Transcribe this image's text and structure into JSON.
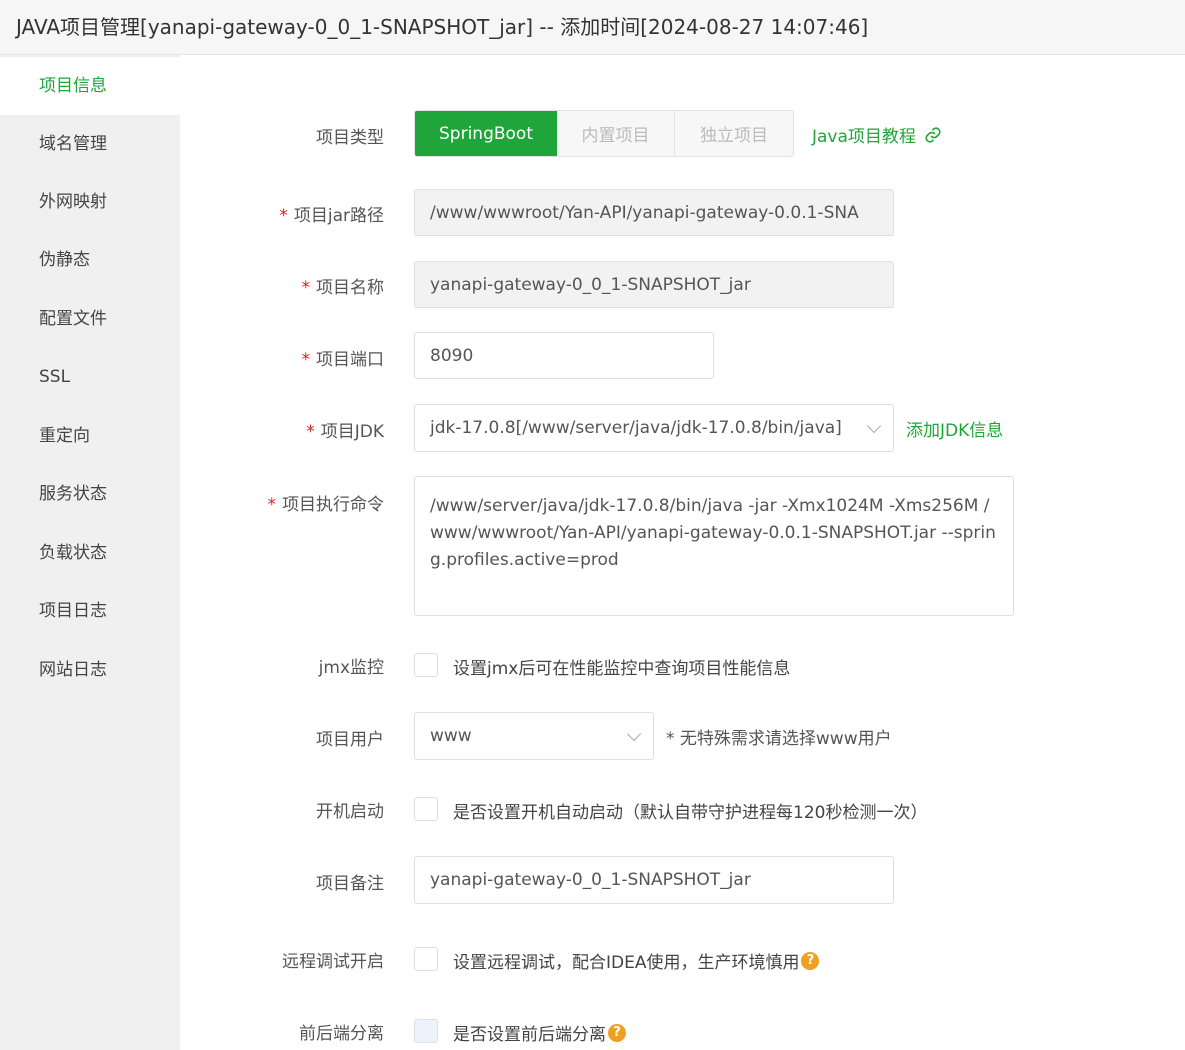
{
  "window": {
    "title": "JAVA项目管理[yanapi-gateway-0_0_1-SNAPSHOT_jar] -- 添加时间[2024-08-27 14:07:46]"
  },
  "sidebar": {
    "items": [
      {
        "label": "项目信息",
        "active": true
      },
      {
        "label": "域名管理"
      },
      {
        "label": "外网映射"
      },
      {
        "label": "伪静态"
      },
      {
        "label": "配置文件"
      },
      {
        "label": "SSL"
      },
      {
        "label": "重定向"
      },
      {
        "label": "服务状态"
      },
      {
        "label": "负载状态"
      },
      {
        "label": "项目日志"
      },
      {
        "label": "网站日志"
      }
    ]
  },
  "form": {
    "type": {
      "label": "项目类型",
      "options": [
        "SpringBoot",
        "内置项目",
        "独立项目"
      ],
      "selected": "SpringBoot",
      "tutorial_link": "Java项目教程"
    },
    "jar_path": {
      "label": "项目jar路径",
      "value": "/www/wwwroot/Yan-API/yanapi-gateway-0.0.1-SNA"
    },
    "name": {
      "label": "项目名称",
      "value": "yanapi-gateway-0_0_1-SNAPSHOT_jar"
    },
    "port": {
      "label": "项目端口",
      "value": "8090"
    },
    "jdk": {
      "label": "项目JDK",
      "value": "jdk-17.0.8[/www/server/java/jdk-17.0.8/bin/java]",
      "add_link": "添加JDK信息"
    },
    "command": {
      "label": "项目执行命令",
      "value": "/www/server/java/jdk-17.0.8/bin/java  -jar -Xmx1024M -Xms256M  /www/wwwroot/Yan-API/yanapi-gateway-0.0.1-SNAPSHOT.jar --spring.profiles.active=prod"
    },
    "jmx": {
      "label": "jmx监控",
      "text": "设置jmx后可在性能监控中查询项目性能信息",
      "checked": false
    },
    "user": {
      "label": "项目用户",
      "value": "www",
      "hint": "* 无特殊需求请选择www用户"
    },
    "autostart": {
      "label": "开机启动",
      "text": "是否设置开机自动启动（默认自带守护进程每120秒检测一次）",
      "checked": false
    },
    "remark": {
      "label": "项目备注",
      "value": "yanapi-gateway-0_0_1-SNAPSHOT_jar"
    },
    "remote_debug": {
      "label": "远程调试开启",
      "text": "设置远程调试，配合IDEA使用，生产环境慎用",
      "checked": false
    },
    "separation": {
      "label": "前后端分离",
      "text": "是否设置前后端分离",
      "checked": false
    }
  },
  "colors": {
    "accent": "#20a53a",
    "required": "#e02020",
    "help": "#f0a020"
  }
}
